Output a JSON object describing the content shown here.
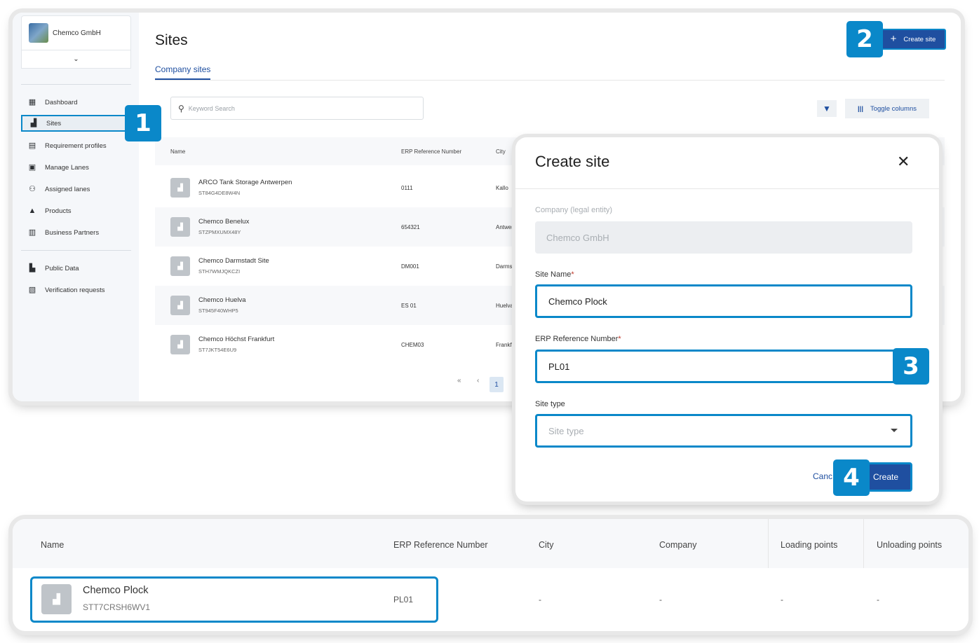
{
  "colors": {
    "accent": "#0a88c9",
    "primary": "#1f4fa0",
    "muted": "#a9aeb3"
  },
  "sidebar": {
    "org_name": "Chemco GmbH",
    "toggle_icon": "chevron-down-icon",
    "items": [
      {
        "label": "Dashboard",
        "icon": "dashboard-icon"
      },
      {
        "label": "Sites",
        "icon": "sites-icon"
      },
      {
        "label": "Requirement profiles",
        "icon": "document-icon"
      },
      {
        "label": "Manage Lanes",
        "icon": "lanes-icon"
      },
      {
        "label": "Assigned lanes",
        "icon": "person-add-icon"
      },
      {
        "label": "Products",
        "icon": "flask-icon"
      },
      {
        "label": "Business Partners",
        "icon": "building-icon"
      },
      {
        "label": "Public Data",
        "icon": "public-data-icon"
      },
      {
        "label": "Verification requests",
        "icon": "verification-icon"
      }
    ]
  },
  "header": {
    "title": "Sites",
    "tab": "Company sites",
    "create_label": "Create site"
  },
  "search": {
    "placeholder": "Keyword Search"
  },
  "toolbar": {
    "toggle_columns": "Toggle columns"
  },
  "table": {
    "headers": {
      "name": "Name",
      "erp": "ERP Reference Number",
      "city": "City"
    },
    "rows": [
      {
        "name": "ARCO Tank Storage Antwerpen",
        "id": "ST84G4DE8W4N",
        "erp": "0111",
        "city": "Kallo"
      },
      {
        "name": "Chemco Benelux",
        "id": "STZPMXUMX48Y",
        "erp": "654321",
        "city": "Antwer"
      },
      {
        "name": "Chemco Darmstadt Site",
        "id": "STH7WMJQKCZI",
        "erp": "DM001",
        "city": "Darmst"
      },
      {
        "name": "Chemco Huelva",
        "id": "ST945F40WHP5",
        "erp": "ES 01",
        "city": "Huelva"
      },
      {
        "name": "Chemco Höchst Frankfurt",
        "id": "ST7JKT54E6U9",
        "erp": "CHEM03",
        "city": "Frankfu"
      }
    ]
  },
  "pager": {
    "first": "«",
    "prev": "‹",
    "current": "1"
  },
  "steps": [
    "1",
    "2",
    "3",
    "4"
  ],
  "modal": {
    "title": "Create site",
    "company_label": "Company (legal entity)",
    "company_value": "Chemco GmbH",
    "site_name_label": "Site Name",
    "site_name_value": "Chemco Plock",
    "erp_label": "ERP Reference Number",
    "erp_value": "PL01",
    "site_type_label": "Site type",
    "site_type_placeholder": "Site type",
    "required_mark": "*",
    "cancel": "Canc",
    "create": "Create"
  },
  "result": {
    "headers": {
      "name": "Name",
      "erp": "ERP Reference Number",
      "city": "City",
      "company": "Company",
      "loading": "Loading points",
      "unloading": "Unloading points"
    },
    "row": {
      "name": "Chemco Plock",
      "id": "STT7CRSH6WV1",
      "erp": "PL01",
      "city": "-",
      "company": "-",
      "loading": "-",
      "unloading": "-"
    }
  }
}
